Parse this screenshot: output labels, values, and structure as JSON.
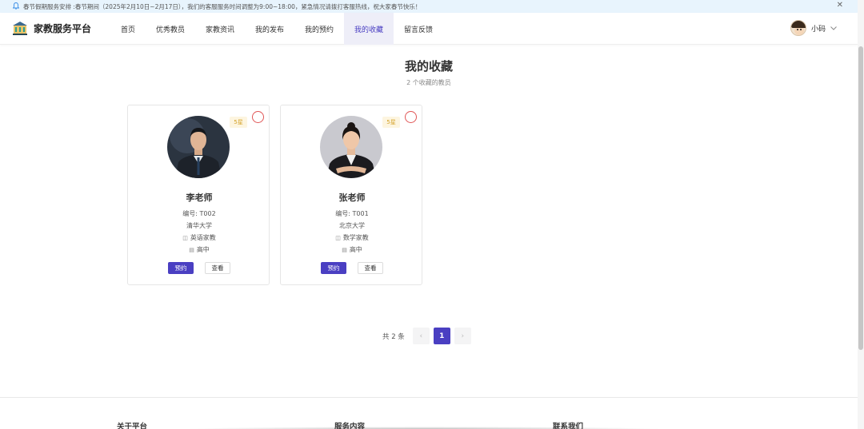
{
  "notice": {
    "text": "春节假期服务安排 :春节期间（2025年2月10日~2月17日），我们的客服服务时间调整为9:00~18:00，紧急情况请拨打客服热线，祝大家春节快乐！",
    "icon": "bell-icon",
    "close_icon": "close-icon",
    "close": "✕"
  },
  "header": {
    "logo_text": "家教服务平台",
    "nav": [
      {
        "label": "首页",
        "active": false
      },
      {
        "label": "优秀教员",
        "active": false
      },
      {
        "label": "家教资讯",
        "active": false
      },
      {
        "label": "我的发布",
        "active": false
      },
      {
        "label": "我的预约",
        "active": false
      },
      {
        "label": "我的收藏",
        "active": true
      },
      {
        "label": "留言反馈",
        "active": false
      }
    ],
    "user_name": "小码",
    "accent_color": "#4a3fc2"
  },
  "main": {
    "title": "我的收藏",
    "subtitle": "2 个收藏的教员",
    "teachers": [
      {
        "tag": "5星",
        "name": "李老师",
        "code": "编号: T002",
        "school": "清华大学",
        "subject": "英语家教",
        "grade": "高中",
        "book_label": "预约",
        "view_label": "查看"
      },
      {
        "tag": "5星",
        "name": "张老师",
        "code": "编号: T001",
        "school": "北京大学",
        "subject": "数学家教",
        "grade": "高中",
        "book_label": "预约",
        "view_label": "查看"
      }
    ]
  },
  "pagination": {
    "total": "共 2 条",
    "prev": "‹",
    "current": "1",
    "next": "›"
  },
  "footer": {
    "col1": "关于平台",
    "col2": "服务内容",
    "col3": "联系我们"
  }
}
